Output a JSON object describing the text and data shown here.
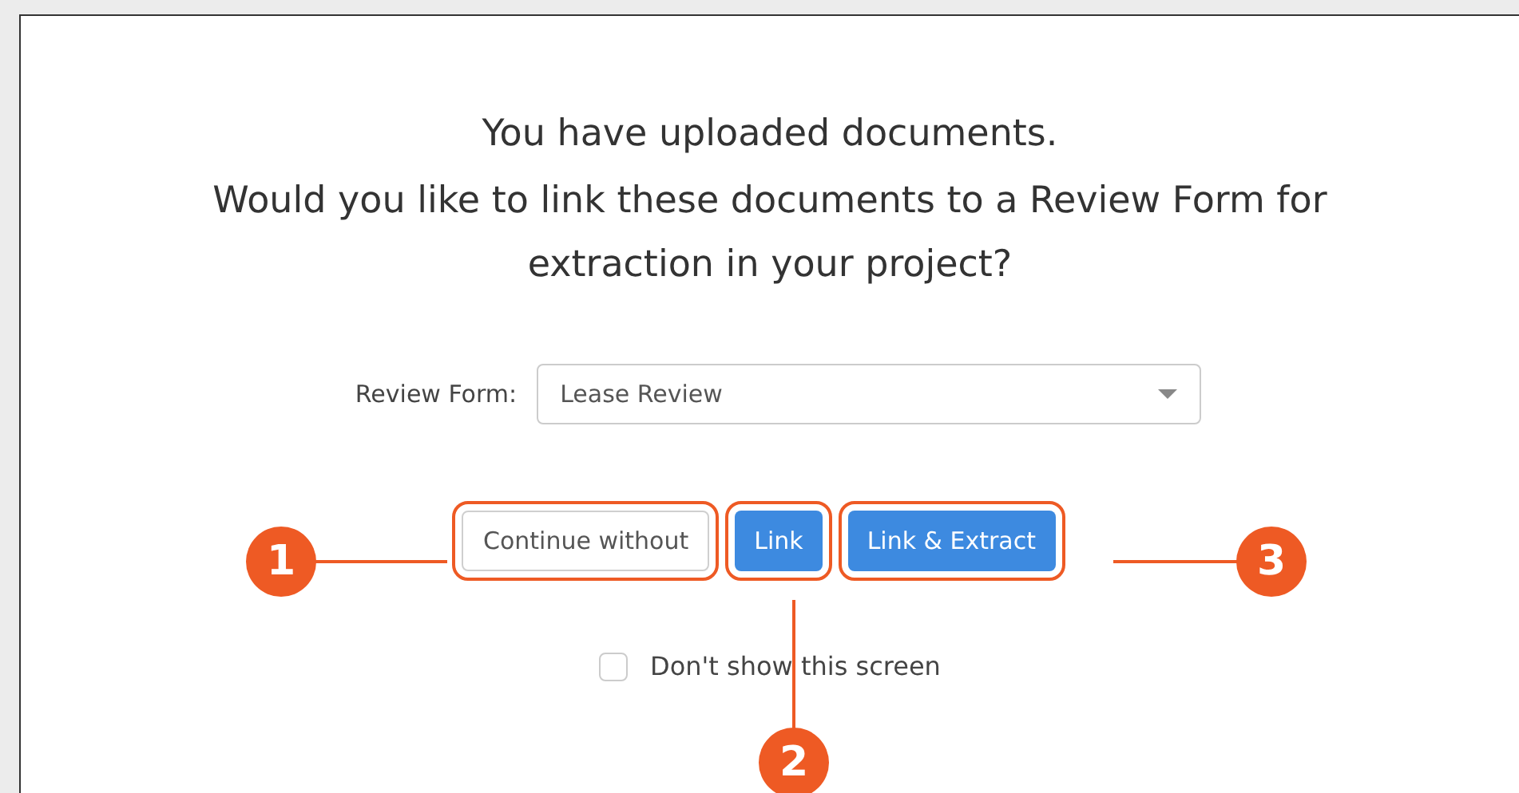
{
  "dialog": {
    "title": "You have uploaded documents.",
    "question": "Would you like to link these documents to a Review Form for extraction in your project?",
    "review_form": {
      "label": "Review Form:",
      "value": "Lease Review"
    },
    "buttons": [
      {
        "label": "Continue without",
        "kind": "secondary"
      },
      {
        "label": "Link",
        "kind": "primary"
      },
      {
        "label": "Link & Extract",
        "kind": "primary"
      }
    ],
    "checkbox": {
      "label": "Don't show this screen",
      "checked": false
    }
  },
  "callouts": [
    "1",
    "2",
    "3"
  ]
}
